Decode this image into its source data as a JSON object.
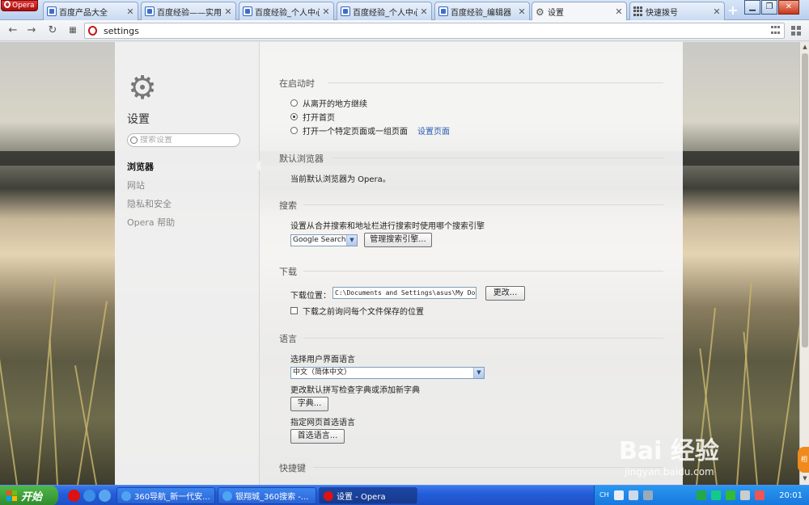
{
  "browser": {
    "menu_label": "Opera",
    "tabs": [
      {
        "label": "百度产品大全",
        "icon": "baidu-favicon"
      },
      {
        "label": "百度经验——实用生活",
        "icon": "baidu-favicon"
      },
      {
        "label": "百度经验_个人中心",
        "icon": "baidu-favicon"
      },
      {
        "label": "百度经验_个人中心",
        "icon": "baidu-favicon"
      },
      {
        "label": "百度经验_编辑器",
        "icon": "baidu-favicon"
      },
      {
        "label": "设置",
        "icon": "gear-icon",
        "active": true
      },
      {
        "label": "快速拨号",
        "icon": "speed-dial-icon"
      }
    ],
    "tab_close_glyph": "✕",
    "newtab_glyph": "+",
    "address": "settings"
  },
  "sidebar": {
    "title": "设置",
    "search_placeholder": "搜索设置",
    "items": [
      {
        "label": "浏览器",
        "active": true
      },
      {
        "label": "网站"
      },
      {
        "label": "隐私和安全"
      },
      {
        "label": "Opera 帮助"
      }
    ]
  },
  "sections": {
    "startup": {
      "title": "在启动时",
      "options": [
        {
          "label": "从离开的地方继续",
          "checked": false
        },
        {
          "label": "打开首页",
          "checked": true
        },
        {
          "label": "打开一个特定页面或一组页面",
          "checked": false
        }
      ],
      "set_pages_link": "设置页面"
    },
    "default_browser": {
      "title": "默认浏览器",
      "text": "当前默认浏览器为 Opera。"
    },
    "search": {
      "title": "搜索",
      "description": "设置从合并搜索和地址栏进行搜索时使用哪个搜索引擎",
      "engine": "Google Search",
      "manage_button": "管理搜索引擎..."
    },
    "downloads": {
      "title": "下载",
      "location_label": "下载位置：",
      "location_value": "C:\\Documents and Settings\\asus\\My Doc",
      "change_button": "更改...",
      "ask_label": "下载之前询问每个文件保存的位置",
      "ask_checked": false
    },
    "language": {
      "title": "语言",
      "ui_language_label": "选择用户界面语言",
      "ui_language_value": "中文（简体中文）",
      "spellcheck_label": "更改默认拼写检查字典或添加新字典",
      "dictionary_button": "字典...",
      "preferred_label": "指定网页首选语言",
      "preferred_button": "首选语言..."
    },
    "shortcuts": {
      "title": "快捷键"
    }
  },
  "watermark": {
    "brand": "Bai 经验",
    "url": "jingyan.baidu.com"
  },
  "taskbar": {
    "start_label": "开始",
    "tasks": [
      {
        "label": "360导航_新一代安...",
        "active": false
      },
      {
        "label": "银翔城_360搜索 -...",
        "active": false
      },
      {
        "label": "设置 - Opera",
        "active": true
      }
    ],
    "tray_language": "CH",
    "clock": "20:01"
  },
  "colors": {
    "accent_link": "#2a5db0",
    "opera_red": "#c41616",
    "taskbar_blue": "#245edb",
    "start_green": "#2f8a2c"
  }
}
